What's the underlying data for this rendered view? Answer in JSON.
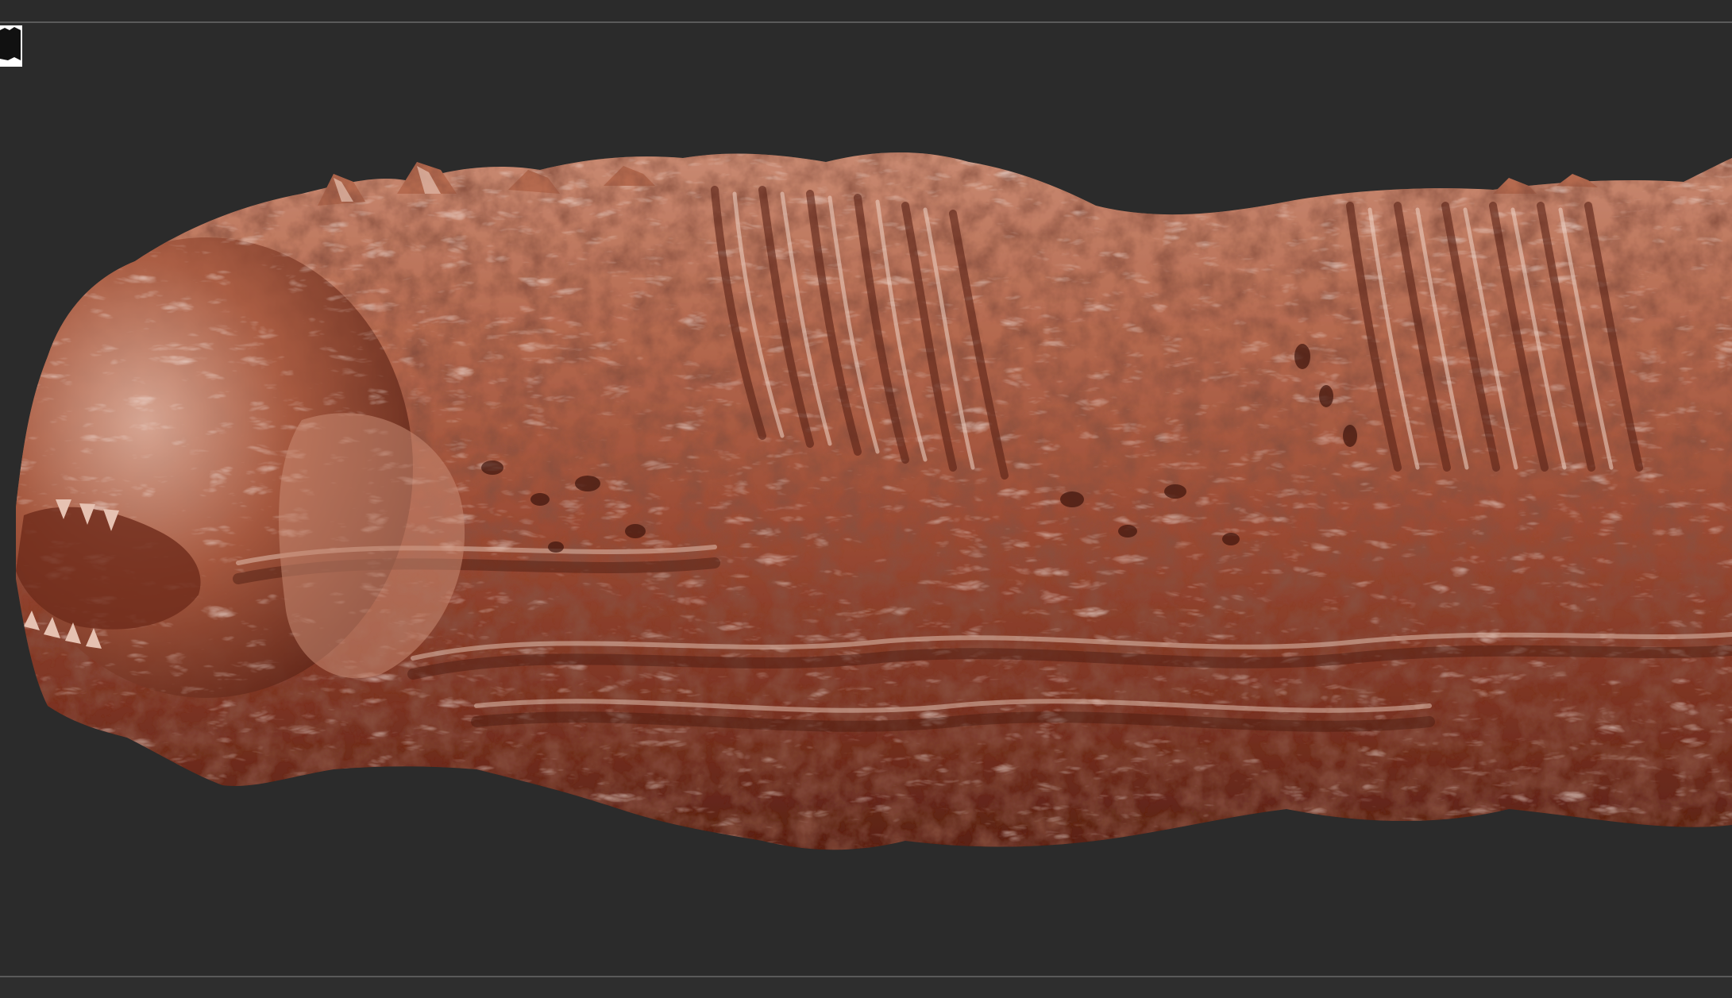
{
  "app": {
    "viewport_label": "",
    "background_color": "#2b2b2b",
    "frame_line_color": "#5a5a5a"
  },
  "model": {
    "material_base_color": "#a2533b",
    "material_highlight_color": "#e8c8b8",
    "material_shadow_color": "#4a1a10"
  },
  "icons": {
    "document": "document-icon"
  }
}
